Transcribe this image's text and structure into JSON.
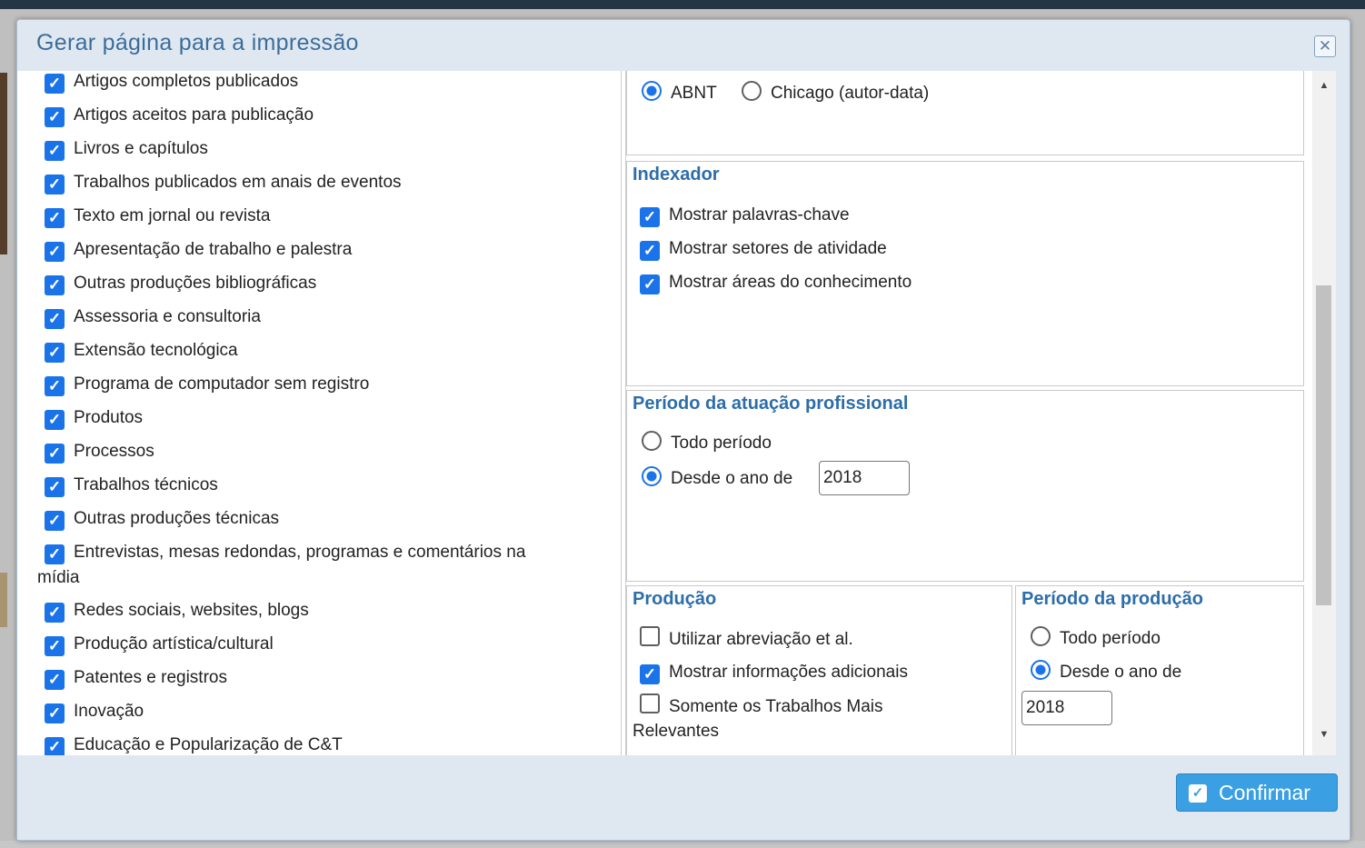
{
  "dialog": {
    "title": "Gerar página para a impressão",
    "close_icon": "close-icon",
    "confirm_label": "Confirmar",
    "confirm_icon": "check-icon"
  },
  "left_items": [
    {
      "label": "Artigos completos publicados",
      "checked": true
    },
    {
      "label": "Artigos aceitos para publicação",
      "checked": true
    },
    {
      "label": "Livros e capítulos",
      "checked": true
    },
    {
      "label": "Trabalhos publicados em anais de eventos",
      "checked": true
    },
    {
      "label": "Texto em jornal ou revista",
      "checked": true
    },
    {
      "label": "Apresentação de trabalho e palestra",
      "checked": true
    },
    {
      "label": "Outras produções bibliográficas",
      "checked": true
    },
    {
      "label": "Assessoria e consultoria",
      "checked": true
    },
    {
      "label": "Extensão tecnológica",
      "checked": true
    },
    {
      "label": "Programa de computador sem registro",
      "checked": true
    },
    {
      "label": "Produtos",
      "checked": true
    },
    {
      "label": "Processos",
      "checked": true
    },
    {
      "label": "Trabalhos técnicos",
      "checked": true
    },
    {
      "label": "Outras produções técnicas",
      "checked": true
    },
    {
      "label": "Entrevistas, mesas redondas, programas e comentários na",
      "label2": "mídia",
      "checked": true
    },
    {
      "label": "Redes sociais, websites, blogs",
      "checked": true
    },
    {
      "label": "Produção artística/cultural",
      "checked": true
    },
    {
      "label": "Patentes e registros",
      "checked": true
    },
    {
      "label": "Inovação",
      "checked": true
    },
    {
      "label": "Educação e Popularização de C&T",
      "checked": true
    }
  ],
  "citation": {
    "options": [
      {
        "label": "ABNT",
        "selected": true
      },
      {
        "label": "Chicago (autor-data)",
        "selected": false
      }
    ]
  },
  "indexador": {
    "title": "Indexador",
    "items": [
      {
        "label": "Mostrar palavras-chave",
        "checked": true
      },
      {
        "label": "Mostrar setores de atividade",
        "checked": true
      },
      {
        "label": "Mostrar áreas do conhecimento",
        "checked": true
      }
    ]
  },
  "periodo_atuacao": {
    "title": "Período da atuação profissional",
    "all_label": "Todo período",
    "since_label": "Desde o ano de",
    "year": "2018",
    "selected": "since"
  },
  "producao": {
    "title": "Produção",
    "items": [
      {
        "label": "Utilizar abreviação et al.",
        "checked": false
      },
      {
        "label": "Mostrar informações adicionais",
        "checked": true
      },
      {
        "label": "Somente os Trabalhos Mais",
        "label2": "Relevantes",
        "checked": false
      }
    ]
  },
  "periodo_producao": {
    "title": "Período da produção",
    "all_label": "Todo período",
    "since_label": "Desde o ano de",
    "year": "2018",
    "selected": "since"
  },
  "scrollbar": {
    "up_icon": "arrow-up-icon",
    "down_icon": "arrow-down-icon"
  }
}
